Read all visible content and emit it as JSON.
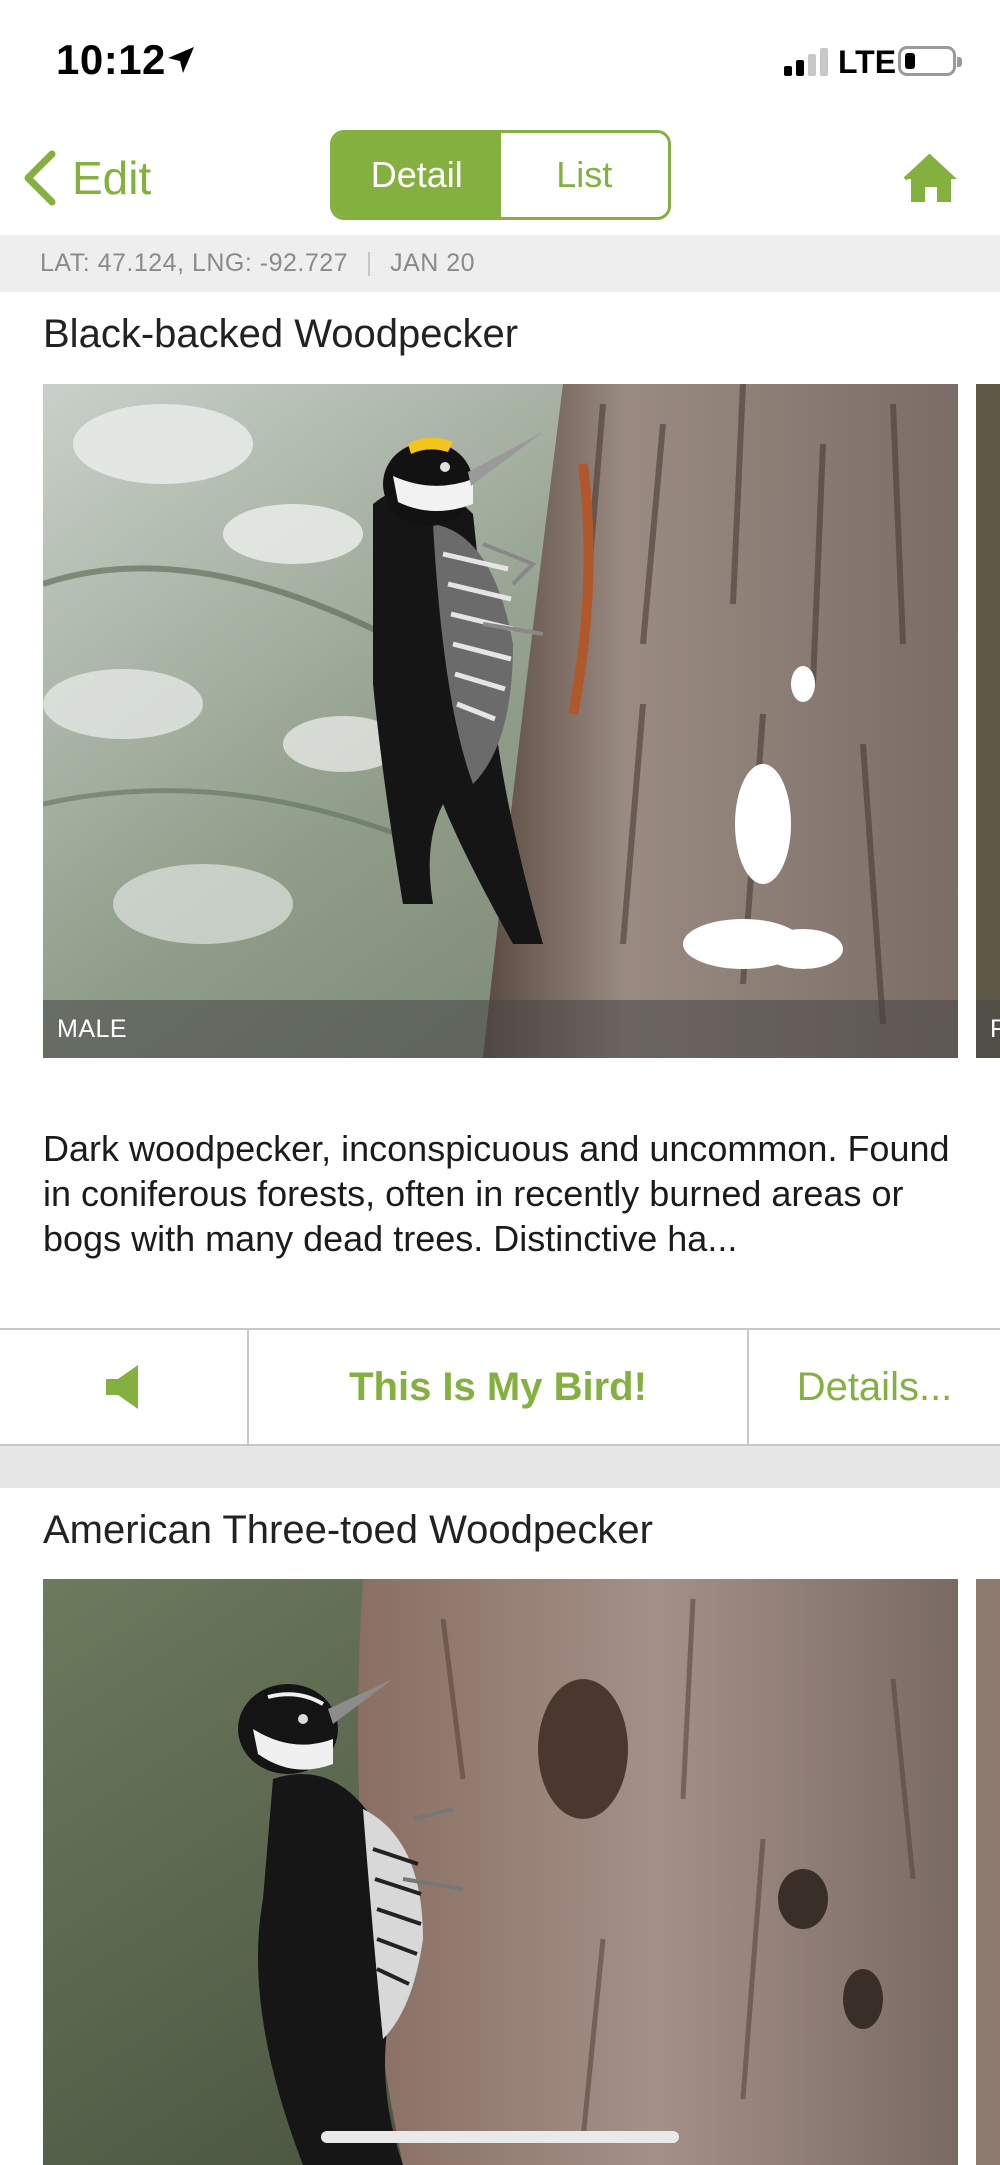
{
  "status_bar": {
    "time": "10:12",
    "network": "LTE",
    "icons": [
      "location-arrow-icon",
      "signal-icon",
      "battery-icon"
    ]
  },
  "nav": {
    "back_label": "Edit",
    "segments": [
      "Detail",
      "List"
    ],
    "active_segment": "Detail",
    "home_icon": "home-icon"
  },
  "location_bar": {
    "coords": "LAT: 47.124, LNG: -92.727",
    "date": "JAN 20"
  },
  "birds": [
    {
      "name": "Black-backed Woodpecker",
      "photo_caption": "MALE",
      "next_photo_caption": "F",
      "description": "Dark woodpecker, inconspicuous and uncommon. Found in coniferous forests, often in recently burned areas or bogs with many dead trees. Distinctive ha..."
    },
    {
      "name": "American Three-toed Woodpecker"
    }
  ],
  "actions": {
    "sound_icon": "speaker-icon",
    "primary_label": "This Is My Bird!",
    "details_label": "Details..."
  },
  "colors": {
    "accent": "#84b03f",
    "location_bar_bg": "#eeeeee",
    "separator": "#c8c8c8"
  }
}
